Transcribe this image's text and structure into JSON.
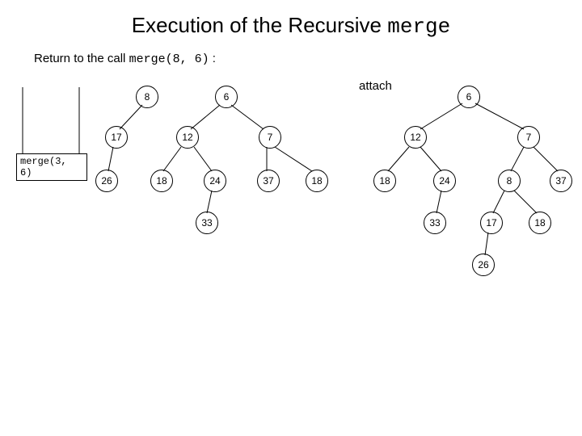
{
  "title_prefix": "Execution of the Recursive ",
  "title_mono": "merge",
  "subtitle_prefix": "Return to the call ",
  "subtitle_mono": "merge(8, 6)",
  "subtitle_suffix": " :",
  "attach_label": "attach",
  "callstack_label": "merge(3, 6)",
  "left": {
    "n8": "8",
    "n6": "6",
    "n17": "17",
    "n12": "12",
    "n7": "7",
    "n26": "26",
    "n18": "18",
    "n24": "24",
    "n37": "37",
    "n18b": "18",
    "n33": "33"
  },
  "right": {
    "n6": "6",
    "n12": "12",
    "n7": "7",
    "n18": "18",
    "n24": "24",
    "n8": "8",
    "n37": "37",
    "n33": "33",
    "n17": "17",
    "n18b": "18",
    "n26": "26"
  }
}
